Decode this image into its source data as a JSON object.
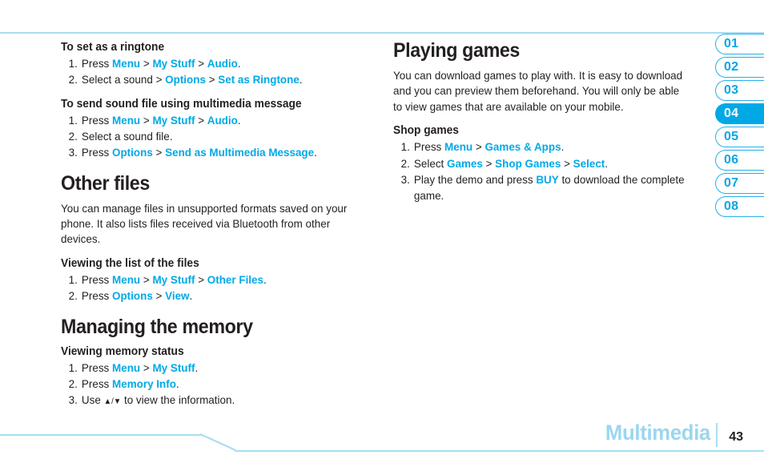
{
  "page": {
    "footer_section": "Multimedia",
    "page_number": "43",
    "accent_blue": "#00a9e6",
    "rule_blue": "#a8ddf3",
    "footer_label_blue": "#9bd6f0"
  },
  "left_column": {
    "blocks": [
      {
        "type": "subhead",
        "text": "To set as a ringtone"
      },
      {
        "type": "steps",
        "items": [
          {
            "num": "1.",
            "parts": [
              {
                "t": "Press ",
                "s": "plain"
              },
              {
                "t": "Menu",
                "s": "key"
              },
              {
                "t": " > ",
                "s": "sep"
              },
              {
                "t": "My Stuff",
                "s": "key"
              },
              {
                "t": " > ",
                "s": "sep"
              },
              {
                "t": "Audio",
                "s": "key"
              },
              {
                "t": ".",
                "s": "plain"
              }
            ]
          },
          {
            "num": "2.",
            "parts": [
              {
                "t": "Select a sound > ",
                "s": "plain"
              },
              {
                "t": "Options",
                "s": "key"
              },
              {
                "t": " > ",
                "s": "sep"
              },
              {
                "t": "Set as Ringtone",
                "s": "key"
              },
              {
                "t": ".",
                "s": "plain"
              }
            ]
          }
        ]
      },
      {
        "type": "subhead",
        "text": "To send sound file using multimedia message"
      },
      {
        "type": "steps",
        "items": [
          {
            "num": "1.",
            "parts": [
              {
                "t": "Press ",
                "s": "plain"
              },
              {
                "t": "Menu",
                "s": "key"
              },
              {
                "t": " > ",
                "s": "sep"
              },
              {
                "t": "My Stuff",
                "s": "key"
              },
              {
                "t": " > ",
                "s": "sep"
              },
              {
                "t": "Audio",
                "s": "key"
              },
              {
                "t": ".",
                "s": "plain"
              }
            ]
          },
          {
            "num": "2.",
            "parts": [
              {
                "t": "Select a sound file.",
                "s": "plain"
              }
            ]
          },
          {
            "num": "3.",
            "parts": [
              {
                "t": "Press ",
                "s": "plain"
              },
              {
                "t": "Options",
                "s": "key"
              },
              {
                "t": " > ",
                "s": "sep"
              },
              {
                "t": "Send as Multimedia Message",
                "s": "key"
              },
              {
                "t": ".",
                "s": "plain"
              }
            ]
          }
        ]
      },
      {
        "type": "heading",
        "text": "Other files"
      },
      {
        "type": "paragraph",
        "text": "You can manage files in unsupported formats saved on your phone. It also lists files received via Bluetooth from other devices."
      },
      {
        "type": "subhead",
        "text": "Viewing the list of the files"
      },
      {
        "type": "steps",
        "items": [
          {
            "num": "1.",
            "parts": [
              {
                "t": "Press ",
                "s": "plain"
              },
              {
                "t": "Menu",
                "s": "key"
              },
              {
                "t": " > ",
                "s": "sep"
              },
              {
                "t": "My Stuff",
                "s": "key"
              },
              {
                "t": " > ",
                "s": "sep"
              },
              {
                "t": "Other Files",
                "s": "key"
              },
              {
                "t": ".",
                "s": "plain"
              }
            ]
          },
          {
            "num": "2.",
            "parts": [
              {
                "t": "Press ",
                "s": "plain"
              },
              {
                "t": "Options",
                "s": "key"
              },
              {
                "t": " > ",
                "s": "sep"
              },
              {
                "t": "View",
                "s": "key"
              },
              {
                "t": ".",
                "s": "plain"
              }
            ]
          }
        ]
      },
      {
        "type": "heading",
        "text": "Managing the memory"
      },
      {
        "type": "subhead",
        "text": "Viewing memory status"
      },
      {
        "type": "steps",
        "items": [
          {
            "num": "1.",
            "parts": [
              {
                "t": "Press ",
                "s": "plain"
              },
              {
                "t": "Menu",
                "s": "key"
              },
              {
                "t": " > ",
                "s": "sep"
              },
              {
                "t": "My Stuff",
                "s": "key"
              },
              {
                "t": ".",
                "s": "plain"
              }
            ]
          },
          {
            "num": "2.",
            "parts": [
              {
                "t": "Press ",
                "s": "plain"
              },
              {
                "t": "Memory Info",
                "s": "key"
              },
              {
                "t": ".",
                "s": "plain"
              }
            ]
          },
          {
            "num": "3.",
            "parts": [
              {
                "t": "Use ",
                "s": "plain"
              },
              {
                "t": "▲/▼",
                "s": "arrows"
              },
              {
                "t": " to view the information.",
                "s": "plain"
              }
            ]
          }
        ]
      }
    ]
  },
  "right_column": {
    "blocks": [
      {
        "type": "heading",
        "text": "Playing games"
      },
      {
        "type": "paragraph",
        "text": "You can download games to play with. It is easy to download and you can preview them beforehand. You will only be able to view games that are available on your mobile."
      },
      {
        "type": "subhead",
        "text": "Shop games"
      },
      {
        "type": "steps",
        "items": [
          {
            "num": "1.",
            "parts": [
              {
                "t": "Press ",
                "s": "plain"
              },
              {
                "t": "Menu",
                "s": "key"
              },
              {
                "t": " > ",
                "s": "sep"
              },
              {
                "t": "Games & Apps",
                "s": "key"
              },
              {
                "t": ".",
                "s": "plain"
              }
            ]
          },
          {
            "num": "2.",
            "parts": [
              {
                "t": "Select ",
                "s": "plain"
              },
              {
                "t": "Games",
                "s": "key"
              },
              {
                "t": " > ",
                "s": "sep"
              },
              {
                "t": "Shop Games",
                "s": "key"
              },
              {
                "t": " > ",
                "s": "sep"
              },
              {
                "t": "Select",
                "s": "key"
              },
              {
                "t": ".",
                "s": "plain"
              }
            ]
          },
          {
            "num": "3.",
            "parts": [
              {
                "t": "Play the demo and press ",
                "s": "plain"
              },
              {
                "t": "BUY",
                "s": "key"
              },
              {
                "t": " to download the complete game.",
                "s": "plain"
              }
            ]
          }
        ]
      }
    ]
  },
  "tabs": [
    {
      "label": "01",
      "active": false
    },
    {
      "label": "02",
      "active": false
    },
    {
      "label": "03",
      "active": false
    },
    {
      "label": "04",
      "active": true
    },
    {
      "label": "05",
      "active": false
    },
    {
      "label": "06",
      "active": false
    },
    {
      "label": "07",
      "active": false
    },
    {
      "label": "08",
      "active": false
    }
  ]
}
